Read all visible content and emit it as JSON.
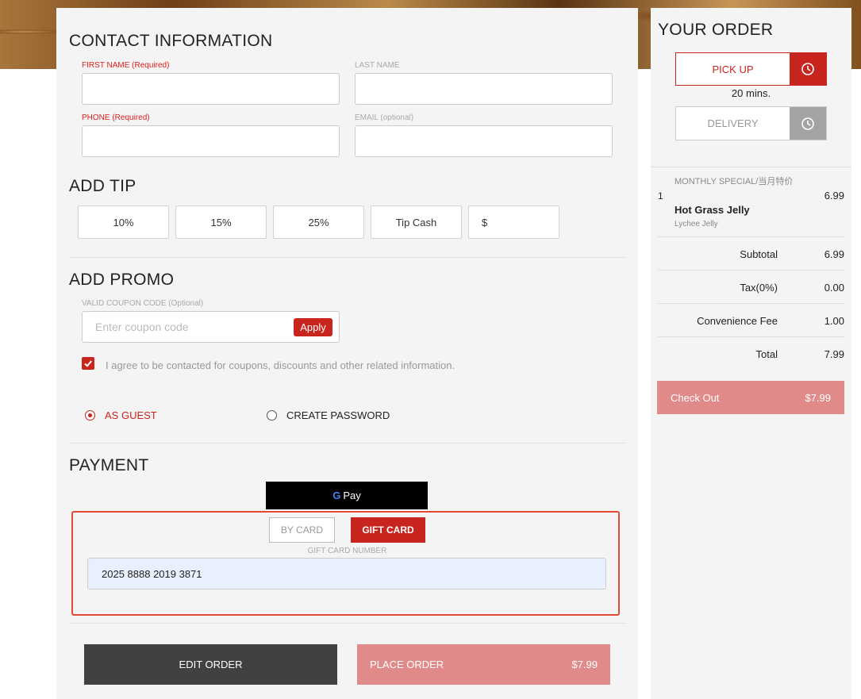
{
  "contact": {
    "title": "CONTACT INFORMATION",
    "first_name_label": "FIRST NAME (Required)",
    "last_name_label": "LAST NAME",
    "phone_label": "PHONE (Required)",
    "email_label": "EMAIL (optional)"
  },
  "tip": {
    "title": "ADD TIP",
    "options": [
      "10%",
      "15%",
      "25%",
      "Tip Cash"
    ],
    "custom_prefix": "$"
  },
  "promo": {
    "title": "ADD PROMO",
    "coupon_label": "VALID COUPON CODE (Optional)",
    "coupon_placeholder": "Enter coupon code",
    "apply_label": "Apply",
    "agree_text": "I agree to be contacted for coupons, discounts and other related information.",
    "agree_checked": true
  },
  "account": {
    "guest_label": "AS GUEST",
    "create_password_label": "CREATE PASSWORD",
    "selected": "guest"
  },
  "payment": {
    "title": "PAYMENT",
    "gpay_label": "Pay",
    "tab_by_card": "BY CARD",
    "tab_gift_card": "GIFT CARD",
    "gift_card_label": "GIFT CARD NUMBER",
    "gift_card_number": "2025 8888 2019 3871"
  },
  "actions": {
    "edit_order_label": "EDIT ORDER",
    "place_order_label": "PLACE ORDER",
    "place_order_amount": "$7.99"
  },
  "order": {
    "title": "YOUR ORDER",
    "pickup_label": "PICK UP",
    "pickup_time": "20 mins.",
    "delivery_label": "DELIVERY",
    "item": {
      "qty": "1",
      "category": "MONTHLY SPECIAL/当月特价",
      "name": "Hot Grass Jelly",
      "option": "Lychee Jelly",
      "price": "6.99"
    },
    "subtotal_label": "Subtotal",
    "subtotal": "6.99",
    "tax_label": "Tax(0%)",
    "tax": "0.00",
    "fee_label": "Convenience Fee",
    "fee": "1.00",
    "total_label": "Total",
    "total": "7.99",
    "checkout_label": "Check Out",
    "checkout_amount": "$7.99"
  },
  "colors": {
    "accent": "#c8251f",
    "accent_light": "#e08b89",
    "dark_button": "#414141",
    "gift_input_bg": "#e9f0fd"
  }
}
